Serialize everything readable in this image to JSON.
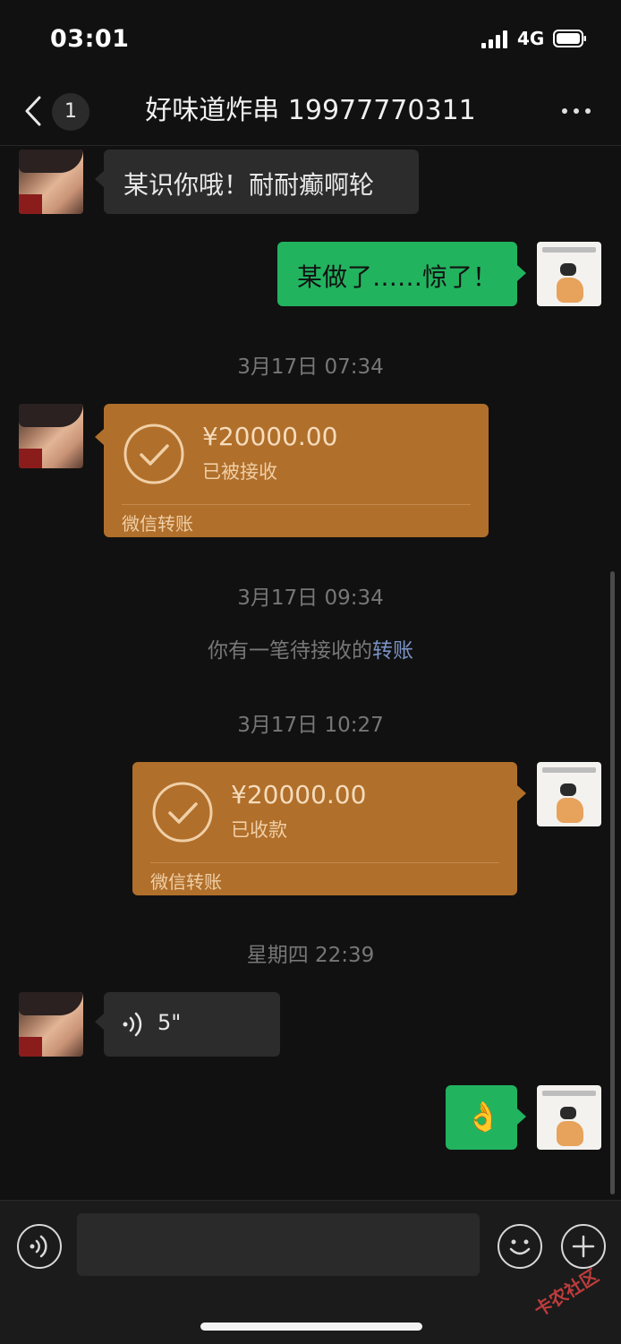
{
  "status_bar": {
    "time": "03:01",
    "network": "4G"
  },
  "header": {
    "unread_count": "1",
    "title": "好味道炸串 19977770311"
  },
  "messages": {
    "m1": {
      "text": "某识你哦！耐耐癫啊轮"
    },
    "m2": {
      "text": "某做了……惊了！"
    },
    "ts1": "3月17日 07:34",
    "t1": {
      "amount": "¥20000.00",
      "status": "已被接收",
      "brand": "微信转账"
    },
    "ts2": "3月17日 09:34",
    "sys": {
      "prefix": "你有一笔待接收的",
      "link": "转账"
    },
    "ts3": "3月17日 10:27",
    "t2": {
      "amount": "¥20000.00",
      "status": "已收款",
      "brand": "微信转账"
    },
    "ts4": "星期四 22:39",
    "voice": {
      "duration": "5\""
    },
    "emoji": {
      "char": "👌"
    }
  },
  "input_bar": {
    "placeholder": ""
  },
  "watermark": "卡农社区",
  "colors": {
    "background": "#111111",
    "incoming_bubble": "#2c2c2c",
    "outgoing_bubble": "#22b35f",
    "transfer_card": "#b06f2b",
    "link": "#7a93c4"
  }
}
